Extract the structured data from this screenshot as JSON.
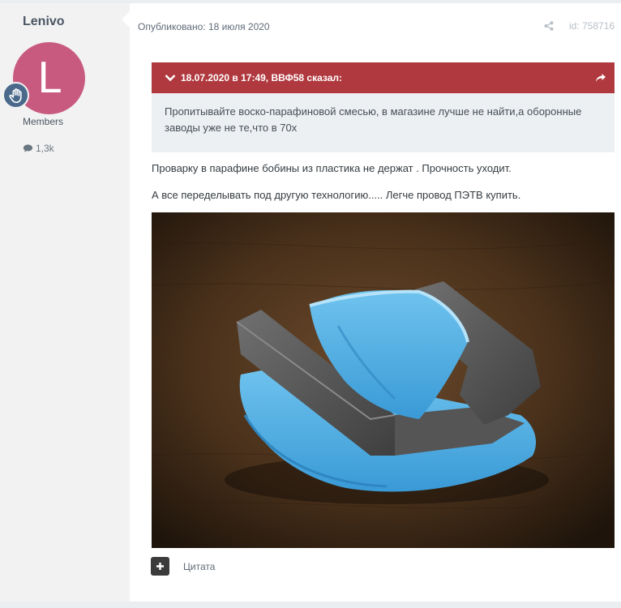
{
  "author": {
    "name": "Lenivo",
    "avatar_letter": "L",
    "avatar_color": "#c85a80",
    "badge_icon": "hand-icon",
    "group": "Members",
    "reputation": "1,3k"
  },
  "post": {
    "published": "Опубликовано: 18 июля 2020",
    "id_label": "id: 758716",
    "quote": {
      "header": "18.07.2020 в 17:49, ВВФ58 сказал:",
      "header_color": "#b0393f",
      "text": "Пропитывайте воско-парафиновой смесью, в магазине лучше не найти,а оборонные заводы уже не те,что в 70х"
    },
    "paragraphs": [
      "Проварку в парафине бобины из пластика не держат . Прочность уходит.",
      "А все переделывать под другую технологию..... Легче провод ПЭТВ купить."
    ],
    "quote_button": "Цитата"
  }
}
